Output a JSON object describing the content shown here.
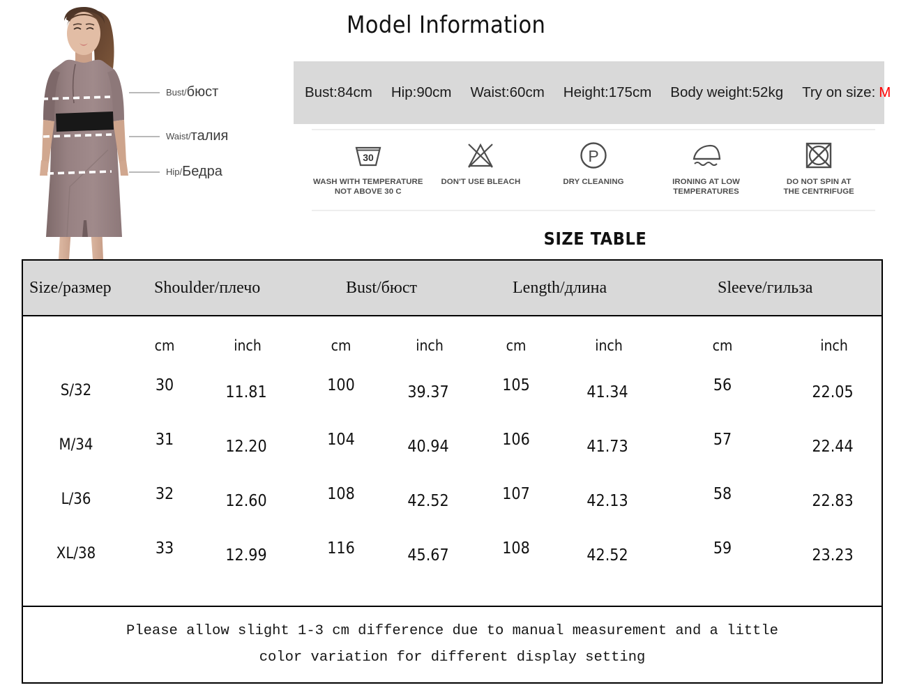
{
  "model_photo": {
    "alt": "female model wearing mauve short-sleeve pencil dress with black waist belt",
    "callouts": [
      {
        "en": "Bust/",
        "ru": "бюст"
      },
      {
        "en": "Waist/",
        "ru": "талия"
      },
      {
        "en": "Hip/",
        "ru": "Бедра"
      }
    ]
  },
  "model_information": {
    "title": "Model Information",
    "band_color": "#d9d9d9",
    "stats": [
      "Bust:84cm",
      "Hip:90cm",
      "Waist:60cm",
      "Height:175cm",
      "Body weight:52kg"
    ],
    "try_on_label": "Try on size:",
    "try_on_size": "M",
    "try_on_size_color": "#ff0000"
  },
  "care_instructions": [
    {
      "icon": "wash-tub-30-icon",
      "label": "WASH WITH TEMPERATURE\nNOT ABOVE 30 C"
    },
    {
      "icon": "no-bleach-icon",
      "label": "DON'T USE BLEACH"
    },
    {
      "icon": "dry-clean-p-icon",
      "label": "DRY CLEANING"
    },
    {
      "icon": "iron-low-temp-icon",
      "label": "IRONING AT LOW\nTEMPERATURES"
    },
    {
      "icon": "no-spin-icon",
      "label": "DO NOT SPIN AT\nTHE CENTRIFUGE"
    }
  ],
  "size_table": {
    "title": "SIZE TABLE",
    "group_headers": [
      "Size/размер",
      "Shoulder/плечо",
      "Bust/бюст",
      "Length/длина",
      "Sleeve/гильза"
    ],
    "unit_labels": [
      "cm",
      "inch",
      "cm",
      "inch",
      "cm",
      "inch",
      "cm",
      "inch"
    ],
    "rows": [
      {
        "size": "S/32",
        "shoulder_cm": "30",
        "shoulder_inch": "11.81",
        "bust_cm": "100",
        "bust_inch": "39.37",
        "length_cm": "105",
        "length_inch": "41.34",
        "sleeve_cm": "56",
        "sleeve_inch": "22.05"
      },
      {
        "size": "M/34",
        "shoulder_cm": "31",
        "shoulder_inch": "12.20",
        "bust_cm": "104",
        "bust_inch": "40.94",
        "length_cm": "106",
        "length_inch": "41.73",
        "sleeve_cm": "57",
        "sleeve_inch": "22.44"
      },
      {
        "size": "L/36",
        "shoulder_cm": "32",
        "shoulder_inch": "12.60",
        "bust_cm": "108",
        "bust_inch": "42.52",
        "length_cm": "107",
        "length_inch": "42.13",
        "sleeve_cm": "58",
        "sleeve_inch": "22.83"
      },
      {
        "size": "XL/38",
        "shoulder_cm": "33",
        "shoulder_inch": "12.99",
        "bust_cm": "116",
        "bust_inch": "45.67",
        "length_cm": "108",
        "length_inch": "42.52",
        "sleeve_cm": "59",
        "sleeve_inch": "23.23"
      }
    ]
  },
  "footer_note": {
    "line1": "Please allow slight 1-3 cm difference due to manual measurement and a little",
    "line2": "color variation for different display setting"
  }
}
